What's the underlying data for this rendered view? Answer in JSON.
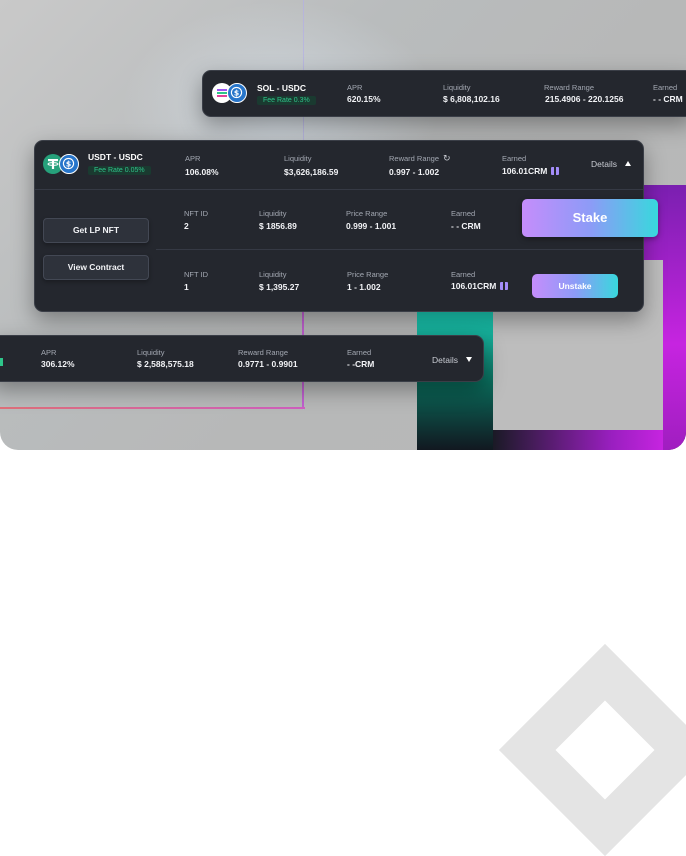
{
  "cards": {
    "sol_usdc": {
      "pair": "SOL - USDC",
      "fee": "Fee Rate 0.3%",
      "apr_label": "APR",
      "apr": "620.15%",
      "liq_label": "Liquidity",
      "liq": "$ 6,808,102.16",
      "reward_label": "Reward Range",
      "reward": "215.4906 - 220.1256",
      "earned_label": "Earned",
      "earned": "- - CRM"
    },
    "usdt_usdc": {
      "pair": "USDT - USDC",
      "fee": "Fee Rate 0.05%",
      "apr_label": "APR",
      "apr": "106.08%",
      "liq_label": "Liquidity",
      "liq": "$3,626,186.59",
      "reward_label": "Reward Range",
      "reward": "0.997 - 1.002",
      "earned_label": "Earned",
      "earned": "106.01CRM",
      "details": "Details",
      "get_lp": "Get LP NFT",
      "view_contract": "View Contract",
      "rows": [
        {
          "nft_label": "NFT ID",
          "nft": "2",
          "liq_label": "Liquidity",
          "liq": "$ 1856.89",
          "range_label": "Price Range",
          "range": "0.999 - 1.001",
          "earned_label": "Earned",
          "earned": "- - CRM",
          "action": "Stake"
        },
        {
          "nft_label": "NFT ID",
          "nft": "1",
          "liq_label": "Liquidity",
          "liq": "$ 1,395.27",
          "range_label": "Price Range",
          "range": "1 - 1.002",
          "earned_label": "Earned",
          "earned": "106.01CRM",
          "action": "Unstake"
        }
      ]
    },
    "third": {
      "apr_label": "APR",
      "apr": "306.12%",
      "liq_label": "Liquidity",
      "liq": "$ 2,588,575.18",
      "reward_label": "Reward Range",
      "reward": "0.9771 - 0.9901",
      "earned_label": "Earned",
      "earned": "- -CRM",
      "details": "Details"
    }
  },
  "colors": {
    "fee_green": "#2ec58a",
    "card_bg": "#24272e",
    "accent_purple": "#c58dfb",
    "accent_teal": "#38d8dd"
  },
  "icons": [
    "sol-coin-icon",
    "usdc-coin-icon",
    "tether-coin-icon",
    "refresh-icon",
    "gift-icon",
    "caret-up-icon",
    "caret-down-icon"
  ]
}
